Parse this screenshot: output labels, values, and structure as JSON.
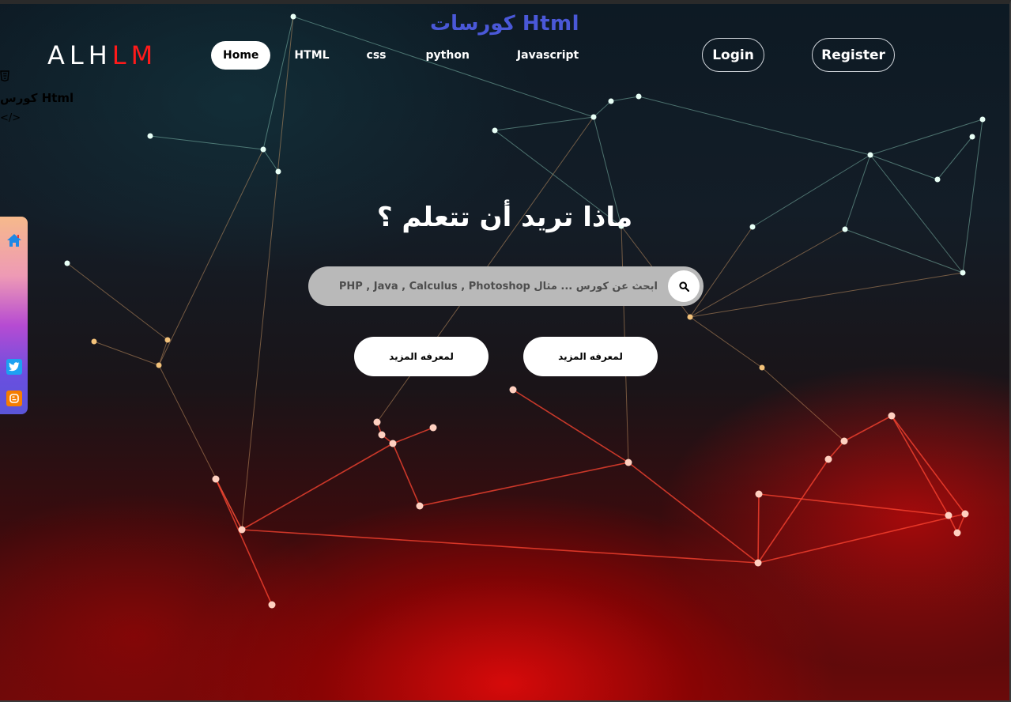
{
  "page_title": "كورسات Html",
  "logo": {
    "part1": "ALH",
    "part2": "LM"
  },
  "nav": {
    "items": [
      {
        "label": "Home"
      },
      {
        "label": "HTML"
      },
      {
        "label": "css"
      },
      {
        "label": "python"
      },
      {
        "label": "Javascript"
      }
    ]
  },
  "auth": {
    "login_label": "Login",
    "register_label": "Register"
  },
  "stub": {
    "icon": "html5-icon",
    "title": "كورس Html",
    "code": "</>"
  },
  "sidebar": {
    "icons": [
      "home-icon",
      "twitter-icon",
      "blogger-icon"
    ]
  },
  "hero": {
    "title": "ماذا تريد أن تتعلم ؟"
  },
  "search": {
    "placeholder": "ابحث عن كورس ... مثال PHP , Java , Calculus , Photoshop"
  },
  "buttons": {
    "learn_more_1": "لمعرفه المزيد",
    "learn_more_2": "لمعرفه المزيد"
  },
  "colors": {
    "accent_title": "#4a58d8",
    "logo_red": "#ff1a1a",
    "twitter": "#1da1f2",
    "blogger": "#f57d00"
  }
}
